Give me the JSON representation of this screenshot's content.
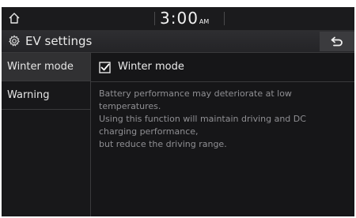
{
  "status_bar": {
    "time": "3:00",
    "ampm": "AM",
    "home_icon": "home-icon"
  },
  "title_bar": {
    "title": "EV settings",
    "settings_icon": "gear-icon",
    "back_icon": "back-arrow-icon"
  },
  "sidebar": {
    "items": [
      {
        "label": "Winter mode",
        "active": true
      },
      {
        "label": "Warning",
        "active": false
      }
    ]
  },
  "content": {
    "winter_mode": {
      "label": "Winter mode",
      "checked": true
    },
    "description_lines": [
      "Battery performance may deteriorate at low",
      "temperatures.",
      "Using this function will maintain driving and DC",
      "charging performance,",
      "but reduce the driving range."
    ]
  },
  "colors": {
    "background": "#161618",
    "title_bar": "#2b2b2e",
    "active_item": "#313133",
    "text": "#e6e6e6",
    "description_text": "#8f8f93"
  }
}
